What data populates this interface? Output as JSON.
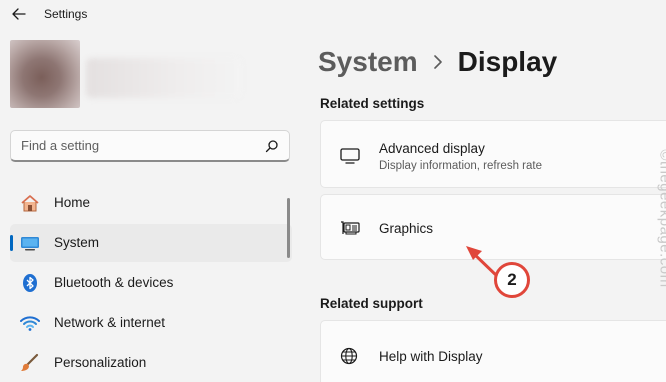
{
  "app": {
    "title": "Settings"
  },
  "search": {
    "placeholder": "Find a setting"
  },
  "sidebar": {
    "items": [
      {
        "label": "Home",
        "icon": "home-icon",
        "active": false
      },
      {
        "label": "System",
        "icon": "monitor-icon",
        "active": true
      },
      {
        "label": "Bluetooth & devices",
        "icon": "bluetooth-icon",
        "active": false
      },
      {
        "label": "Network & internet",
        "icon": "wifi-icon",
        "active": false
      },
      {
        "label": "Personalization",
        "icon": "paint-brush-icon",
        "active": false
      }
    ]
  },
  "breadcrumb": {
    "parent": "System",
    "current": "Display"
  },
  "related_settings": {
    "heading": "Related settings",
    "items": [
      {
        "title": "Advanced display",
        "subtitle": "Display information, refresh rate",
        "icon": "monitor-outline-icon"
      },
      {
        "title": "Graphics",
        "icon": "graphics-card-icon"
      }
    ]
  },
  "related_support": {
    "heading": "Related support",
    "items": [
      {
        "title": "Help with Display",
        "icon": "globe-icon"
      }
    ]
  },
  "annotation": {
    "number": "2",
    "color": "#e0463a"
  },
  "watermark": "©thegeekpage.com",
  "colors": {
    "accent": "#0067c0",
    "background": "#f3f3f3",
    "card": "#fbfbfb"
  }
}
